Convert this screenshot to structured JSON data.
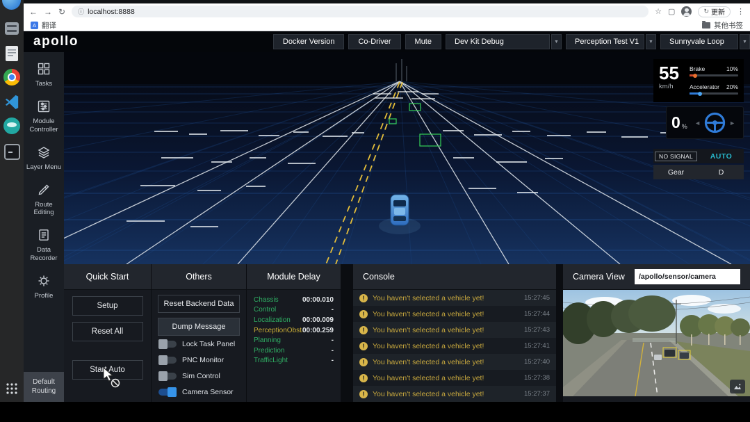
{
  "browser": {
    "url": "localhost:8888",
    "update_button": "更新",
    "bookmarks": {
      "translate": "翻译",
      "other_bookmarks": "其他书签"
    }
  },
  "icons": {
    "back": "←",
    "forward": "→",
    "reload": "↻",
    "info": "ⓘ",
    "star": "☆",
    "side_panel": "▢",
    "menu": "⋮",
    "translate_letter": "A",
    "dropdown_arrow": "▼",
    "warning": "!",
    "steer_left": "◄",
    "steer_right": "►",
    "update_reload": "↻"
  },
  "header": {
    "logo": "apollo",
    "buttons": [
      {
        "label": "Docker Version"
      },
      {
        "label": "Co-Driver"
      },
      {
        "label": "Mute"
      }
    ],
    "dropdowns": [
      {
        "label": "Dev Kit Debug"
      },
      {
        "label": "Perception Test V1"
      },
      {
        "label": "Sunnyvale Loop"
      }
    ]
  },
  "sidebar": {
    "items": [
      {
        "label": "Tasks"
      },
      {
        "label": "Module Controller"
      },
      {
        "label": "Layer Menu"
      },
      {
        "label": "Route Editing"
      },
      {
        "label": "Data Recorder"
      },
      {
        "label": "Profile"
      },
      {
        "label": "Default Routing"
      }
    ]
  },
  "dashboard": {
    "speed_value": "55",
    "speed_unit": "km/h",
    "brake_label": "Brake",
    "brake_percent": "10%",
    "accelerator_label": "Accelerator",
    "accelerator_percent": "20%",
    "wheel_value": "0",
    "wheel_unit": "%",
    "signal_status": "NO SIGNAL",
    "drive_mode": "AUTO",
    "gear_label": "Gear",
    "gear_value": "D"
  },
  "panels": {
    "quick_start": {
      "title": "Quick Start",
      "buttons": [
        {
          "label": "Setup"
        },
        {
          "label": "Reset All"
        },
        {
          "label": "Start Auto"
        }
      ]
    },
    "others": {
      "title": "Others",
      "buttons": [
        {
          "label": "Reset Backend Data"
        },
        {
          "label": "Dump Message"
        }
      ],
      "toggles": [
        {
          "label": "Lock Task Panel",
          "on": false
        },
        {
          "label": "PNC Monitor",
          "on": false
        },
        {
          "label": "Sim Control",
          "on": false
        },
        {
          "label": "Camera Sensor",
          "on": true
        }
      ]
    },
    "module_delay": {
      "title": "Module Delay",
      "rows": [
        {
          "name": "Chassis",
          "value": "00:00.010",
          "status": "ok"
        },
        {
          "name": "Control",
          "value": "-",
          "status": "ok"
        },
        {
          "name": "Localization",
          "value": "00:00.009",
          "status": "ok"
        },
        {
          "name": "PerceptionObstacl",
          "value": "00:00.259",
          "status": "warn"
        },
        {
          "name": "Planning",
          "value": "-",
          "status": "ok"
        },
        {
          "name": "Prediction",
          "value": "-",
          "status": "ok"
        },
        {
          "name": "TrafficLight",
          "value": "-",
          "status": "ok"
        }
      ]
    },
    "console": {
      "title": "Console",
      "messages": [
        {
          "text": "You haven't selected a vehicle yet!",
          "time": "15:27:45"
        },
        {
          "text": "You haven't selected a vehicle yet!",
          "time": "15:27:44"
        },
        {
          "text": "You haven't selected a vehicle yet!",
          "time": "15:27:43"
        },
        {
          "text": "You haven't selected a vehicle yet!",
          "time": "15:27:41"
        },
        {
          "text": "You haven't selected a vehicle yet!",
          "time": "15:27:40"
        },
        {
          "text": "You haven't selected a vehicle yet!",
          "time": "15:27:38"
        },
        {
          "text": "You haven't selected a vehicle yet!",
          "time": "15:27:37"
        }
      ]
    },
    "camera": {
      "title": "Camera View",
      "topic": "/apollo/sensor/camera"
    }
  },
  "colors": {
    "accent_blue": "#2f7bd8",
    "warning_yellow": "#d9b64a",
    "module_green": "#2fae63",
    "auto_teal": "#27b8cc",
    "detection_green": "#35d058",
    "lane_yellow": "#e3bd3a"
  }
}
